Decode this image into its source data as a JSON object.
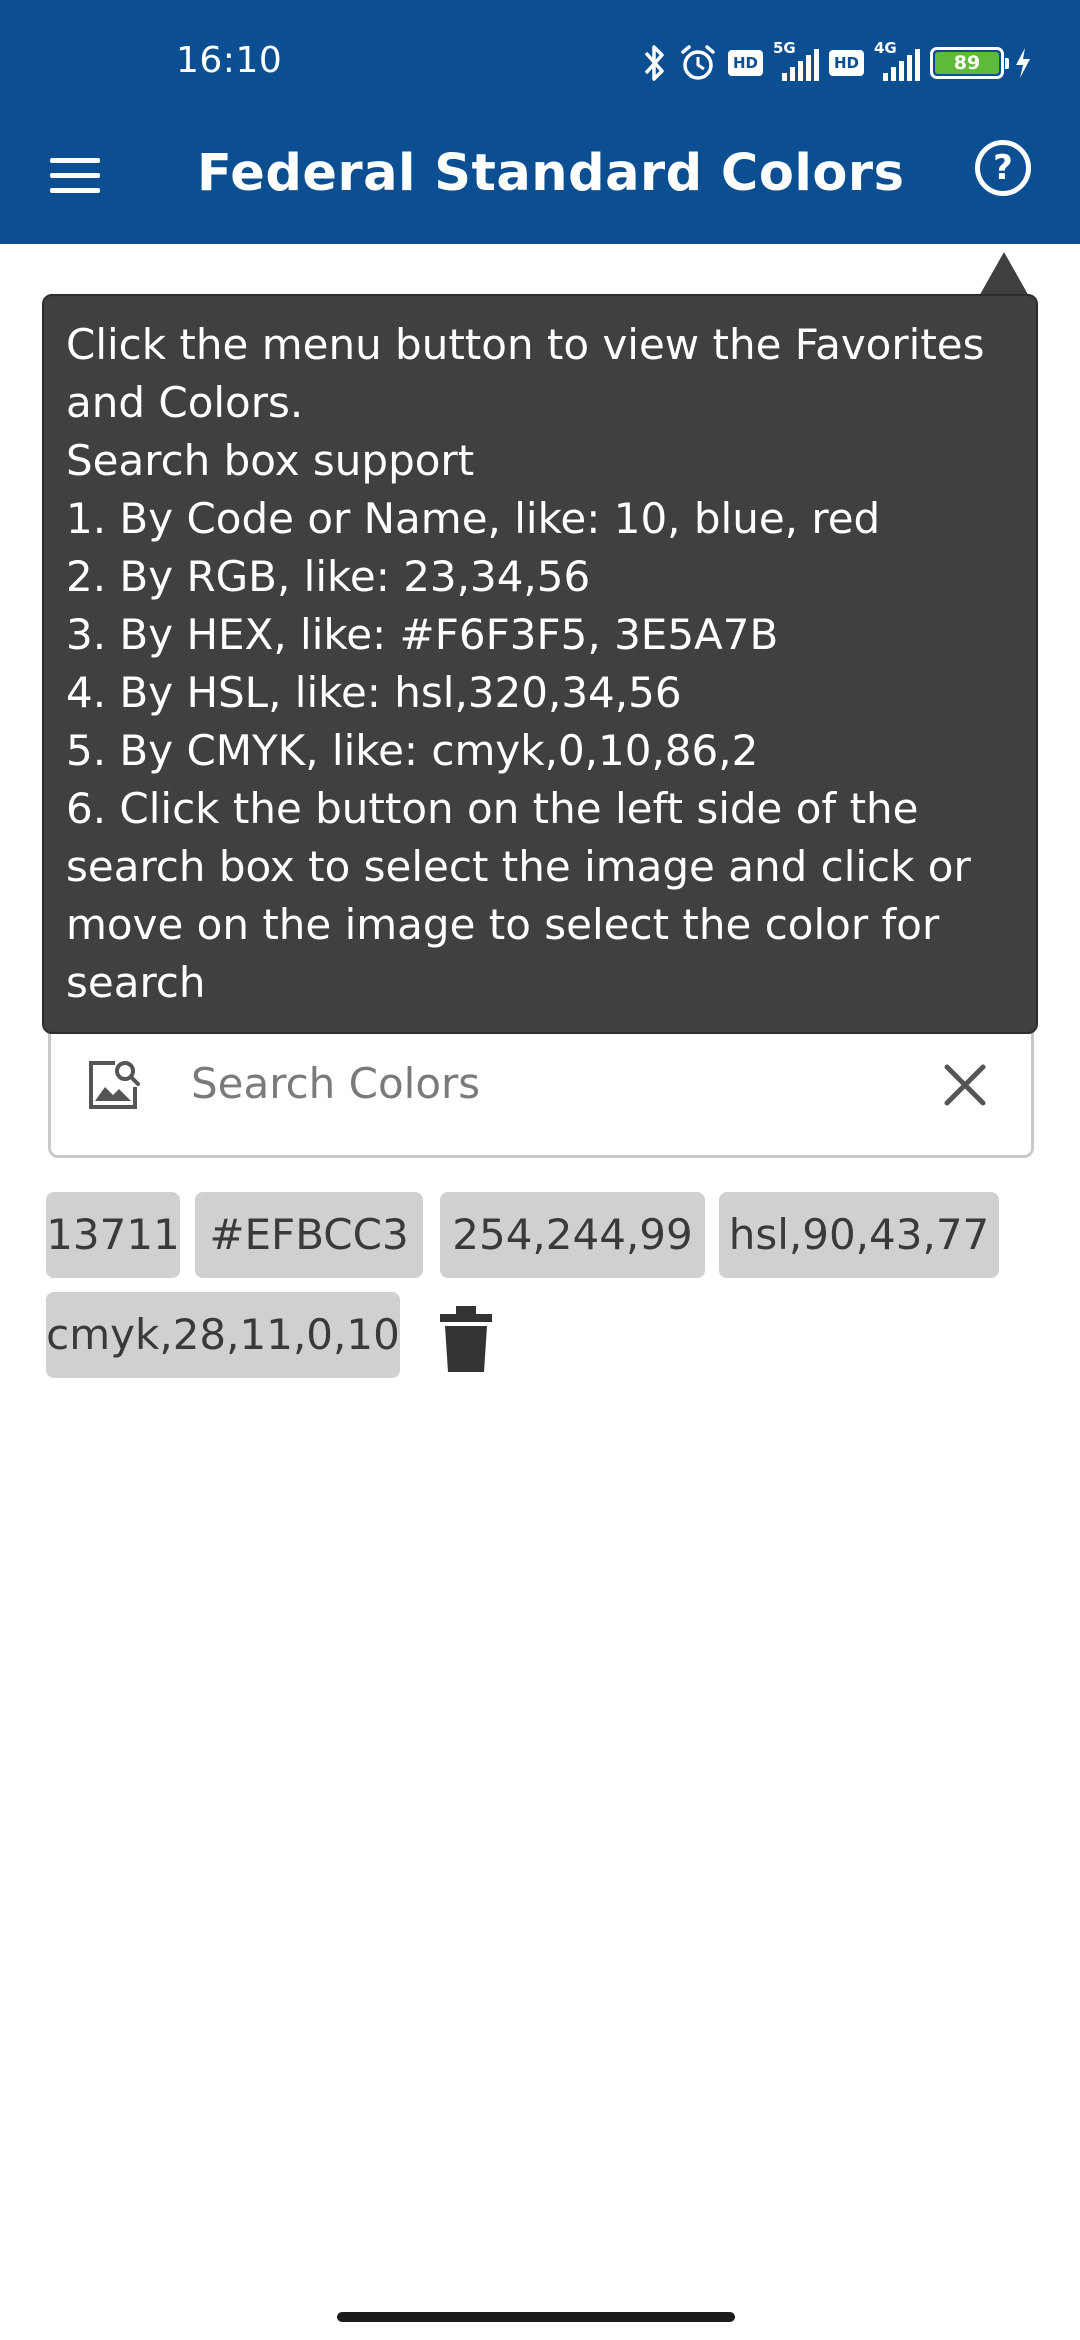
{
  "status_bar": {
    "time": "16:10",
    "network_1": "5G",
    "network_2": "4G",
    "hd_label": "HD",
    "battery": "89"
  },
  "app_bar": {
    "title": "Federal Standard Colors"
  },
  "tooltip": {
    "lines": [
      "Click the menu button to view the Favorites",
      "and Colors.",
      "Search box support",
      "1. By Code or Name, like: 10, blue, red",
      "2. By RGB, like: 23,34,56",
      "3. By HEX, like: #F6F3F5, 3E5A7B",
      "4. By HSL, like: hsl,320,34,56",
      "5. By CMYK, like: cmyk,0,10,86,2",
      "6. Click the button on the left side of the",
      "search box to select the image and click or",
      "move on the image to select the color for",
      "search"
    ]
  },
  "search": {
    "placeholder": "Search Colors",
    "value": ""
  },
  "history_chips": [
    "13711",
    "#EFBCC3",
    "254,244,99",
    "hsl,90,43,77",
    "cmyk,28,11,0,10"
  ],
  "colors": {
    "app_bar": "#0b4f92",
    "tooltip_bg": "#404040",
    "chip_bg": "#d0d0d0",
    "battery_fill": "#5dbb38"
  },
  "icons": {
    "menu": "menu-icon",
    "help": "help-circle-icon",
    "image_picker": "image-search-icon",
    "clear": "close-icon",
    "delete": "trash-icon"
  }
}
